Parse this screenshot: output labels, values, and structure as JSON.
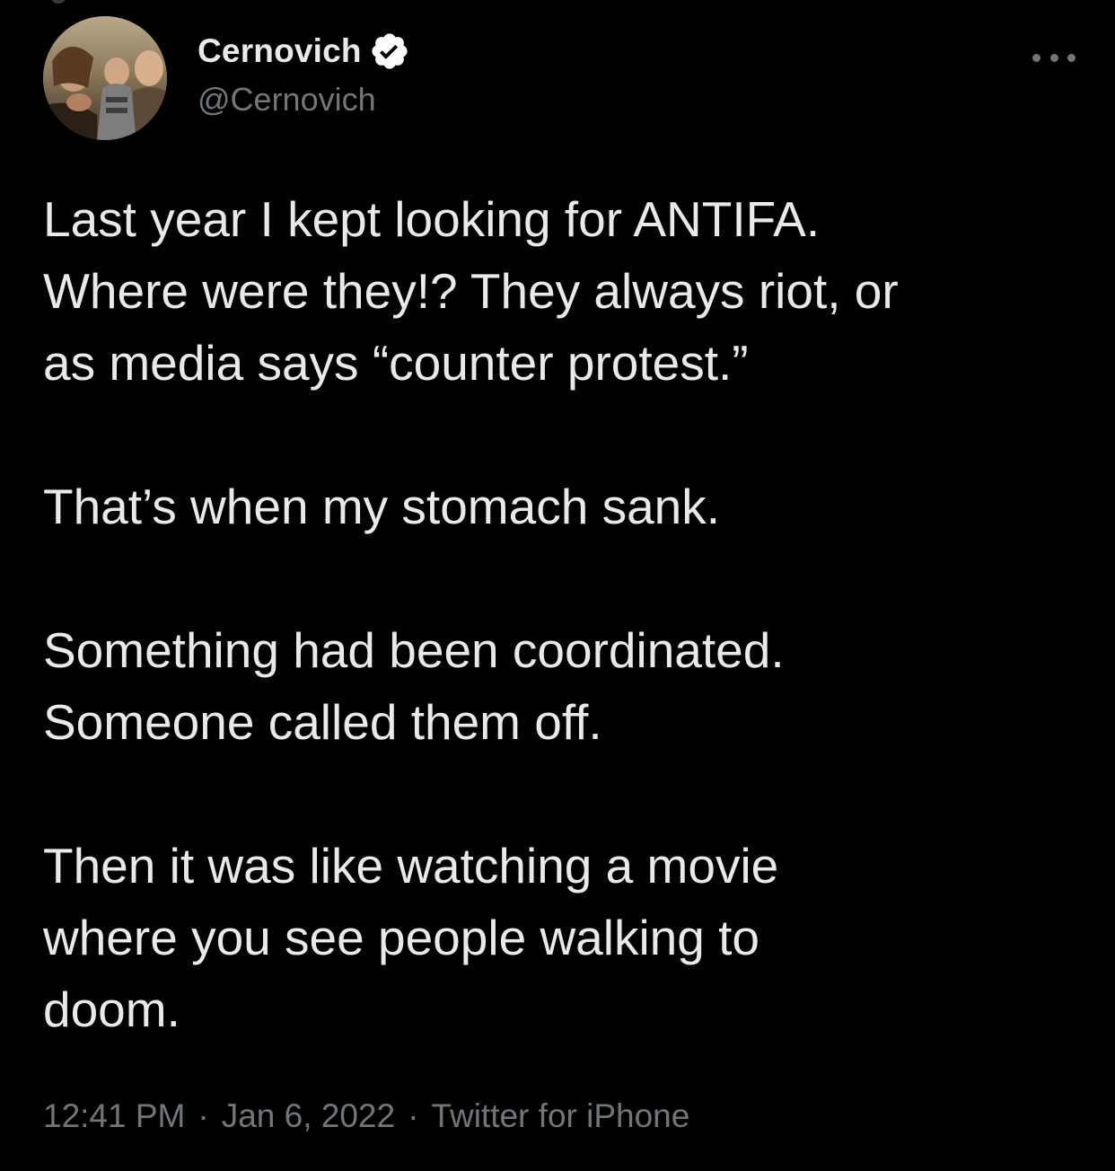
{
  "tweet": {
    "author": {
      "display_name": "Cernovich",
      "handle": "@Cernovich",
      "verified": true
    },
    "more_icon": "more-horizontal-icon",
    "paragraphs": [
      "Last year I kept looking for ANTIFA.\nWhere were they!? They always riot, or\nas media says “counter protest.”",
      "That’s when my stomach sank.",
      "Something had been coordinated.\nSomeone called them off.",
      "Then it was like watching a movie\nwhere you see people walking to\ndoom."
    ],
    "meta": {
      "time": "12:41 PM",
      "date": "Jan 6, 2022",
      "source": "Twitter for iPhone",
      "separator": "·"
    }
  },
  "colors": {
    "background": "#000000",
    "text": "#e7e9ea",
    "secondary": "#71767b",
    "verified_badge": "#ffffff"
  }
}
